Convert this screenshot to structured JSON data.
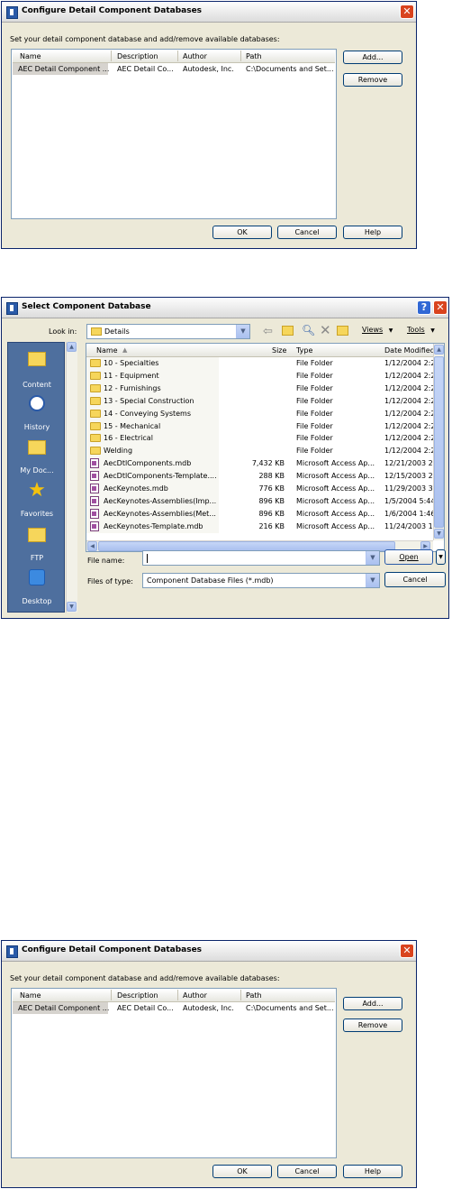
{
  "dialog1": {
    "title": "Configure Detail Component Databases",
    "instruction": "Set your detail component database and add/remove available databases:",
    "columns": [
      "Name",
      "Description",
      "Author",
      "Path"
    ],
    "row": {
      "name": "AEC Detail Component ...",
      "description": "AEC Detail Co...",
      "author": "Autodesk, Inc.",
      "path": "C:\\Documents and Set..."
    },
    "buttons": {
      "add": "Add...",
      "remove": "Remove",
      "ok": "OK",
      "cancel": "Cancel",
      "help": "Help"
    }
  },
  "dialog2": {
    "title": "Select Component Database",
    "help_button": "?",
    "look_in_label": "Look in:",
    "look_in_value": "Details",
    "views_label": "Views",
    "tools_label": "Tools",
    "places": [
      {
        "label": "Content",
        "icon": "folder-icon"
      },
      {
        "label": "History",
        "icon": "history-icon"
      },
      {
        "label": "My Doc...",
        "icon": "my-documents-icon"
      },
      {
        "label": "Favorites",
        "icon": "star-icon"
      },
      {
        "label": "FTP",
        "icon": "ftp-icon"
      },
      {
        "label": "Desktop",
        "icon": "desktop-icon"
      }
    ],
    "columns": {
      "name": "Name",
      "size": "Size",
      "type": "Type",
      "date": "Date Modified"
    },
    "files": [
      {
        "name": "10 - Specialties",
        "size": "",
        "type": "File Folder",
        "date": "1/12/2004 2:2",
        "kind": "folder"
      },
      {
        "name": "11 - Equipment",
        "size": "",
        "type": "File Folder",
        "date": "1/12/2004 2:2",
        "kind": "folder"
      },
      {
        "name": "12 - Furnishings",
        "size": "",
        "type": "File Folder",
        "date": "1/12/2004 2:2",
        "kind": "folder"
      },
      {
        "name": "13 - Special Construction",
        "size": "",
        "type": "File Folder",
        "date": "1/12/2004 2:2",
        "kind": "folder"
      },
      {
        "name": "14 - Conveying Systems",
        "size": "",
        "type": "File Folder",
        "date": "1/12/2004 2:2",
        "kind": "folder"
      },
      {
        "name": "15 - Mechanical",
        "size": "",
        "type": "File Folder",
        "date": "1/12/2004 2:2",
        "kind": "folder"
      },
      {
        "name": "16 - Electrical",
        "size": "",
        "type": "File Folder",
        "date": "1/12/2004 2:2",
        "kind": "folder"
      },
      {
        "name": "Welding",
        "size": "",
        "type": "File Folder",
        "date": "1/12/2004 2:2",
        "kind": "folder"
      },
      {
        "name": "AecDtlComponents.mdb",
        "size": "7,432 KB",
        "type": "Microsoft Access Ap...",
        "date": "12/21/2003 2:",
        "kind": "mdb"
      },
      {
        "name": "AecDtlComponents-Template....",
        "size": "288 KB",
        "type": "Microsoft Access Ap...",
        "date": "12/15/2003 2:",
        "kind": "mdb"
      },
      {
        "name": "AecKeynotes.mdb",
        "size": "776 KB",
        "type": "Microsoft Access Ap...",
        "date": "11/29/2003 3:",
        "kind": "mdb"
      },
      {
        "name": "AecKeynotes-Assemblies(Imp...",
        "size": "896 KB",
        "type": "Microsoft Access Ap...",
        "date": "1/5/2004 5:44",
        "kind": "mdb"
      },
      {
        "name": "AecKeynotes-Assemblies(Met...",
        "size": "896 KB",
        "type": "Microsoft Access Ap...",
        "date": "1/6/2004 1:46",
        "kind": "mdb"
      },
      {
        "name": "AecKeynotes-Template.mdb",
        "size": "216 KB",
        "type": "Microsoft Access Ap...",
        "date": "11/24/2003 1",
        "kind": "mdb"
      }
    ],
    "file_name_label": "File name:",
    "file_name_value": "",
    "files_of_type_label": "Files of type:",
    "files_of_type_value": "Component Database Files (*.mdb)",
    "open_button": "Open",
    "cancel_button": "Cancel"
  },
  "dialog3": {
    "title": "Configure Detail Component Databases",
    "instruction": "Set your detail component database and add/remove available databases:",
    "columns": [
      "Name",
      "Description",
      "Author",
      "Path"
    ],
    "row": {
      "name": "AEC Detail Component ...",
      "description": "AEC Detail Co...",
      "author": "Autodesk, Inc.",
      "path": "C:\\Documents and Set..."
    },
    "buttons": {
      "add": "Add...",
      "remove": "Remove",
      "ok": "OK",
      "cancel": "Cancel",
      "help": "Help"
    }
  }
}
